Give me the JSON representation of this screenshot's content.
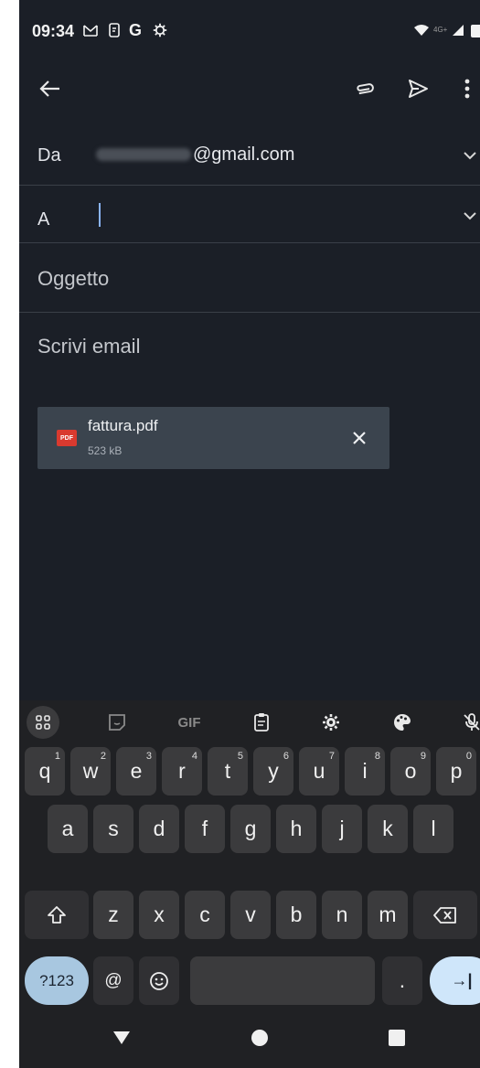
{
  "status_bar": {
    "time": "09:34",
    "left_icons": [
      "gmail-icon",
      "screenshot-icon",
      "google-g-icon",
      "settings-gear-icon"
    ],
    "right_icons": [
      "wifi-icon",
      "signal-icon",
      "battery-icon"
    ],
    "network": "4G+"
  },
  "toolbar": {
    "back_icon": "arrow-left-icon",
    "attach_icon": "paperclip-icon",
    "send_icon": "send-icon",
    "more_icon": "more-vert-icon"
  },
  "compose": {
    "from_label": "Da",
    "from_value": "@gmail.com",
    "to_label": "A",
    "to_value": "",
    "subject_placeholder": "Oggetto",
    "body_placeholder": "Scrivi email"
  },
  "attachment": {
    "badge": "PDF",
    "file_name": "fattura.pdf",
    "file_size": "523 kB"
  },
  "keyboard": {
    "toolbar_icons": [
      "apps-grid-icon",
      "sticker-icon",
      "gif-icon",
      "clipboard-icon",
      "settings-icon",
      "palette-icon",
      "mic-off-icon"
    ],
    "gif_label": "GIF",
    "row1": [
      "q",
      "w",
      "e",
      "r",
      "t",
      "y",
      "u",
      "i",
      "o",
      "p"
    ],
    "row1_hints": [
      "1",
      "2",
      "3",
      "4",
      "5",
      "6",
      "7",
      "8",
      "9",
      "0"
    ],
    "row2": [
      "a",
      "s",
      "d",
      "f",
      "g",
      "h",
      "j",
      "k",
      "l"
    ],
    "row3": [
      "z",
      "x",
      "c",
      "v",
      "b",
      "n",
      "m"
    ],
    "symbols_label": "?123",
    "at_key": "@",
    "period_key": ".",
    "enter_label": "→|"
  },
  "nav_bar": {
    "back": "triangle-back-icon",
    "home": "circle-home-icon",
    "recents": "square-recents-icon"
  }
}
